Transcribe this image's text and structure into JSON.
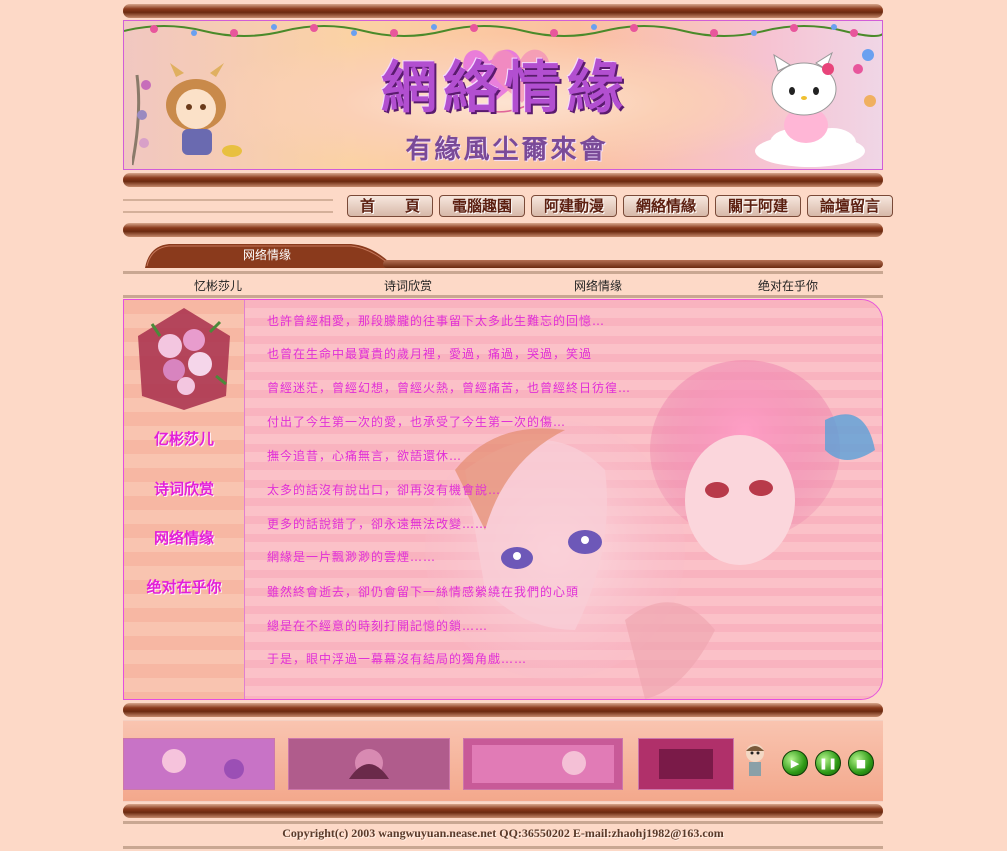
{
  "banner": {
    "title": "網絡情緣",
    "subtitle": "有緣風尘爾來會"
  },
  "nav": {
    "buttons": [
      "首　　頁",
      "電腦趣園",
      "阿建動漫",
      "網絡情緣",
      "關于阿建",
      "論壇留言"
    ]
  },
  "section_tab": {
    "label": "网络情缘"
  },
  "sub_links": [
    "忆彬莎儿",
    "诗词欣赏",
    "网络情缘",
    "绝对在乎你"
  ],
  "sidebar": {
    "items": [
      "亿彬莎儿",
      "诗词欣赏",
      "网络情缘",
      "绝对在乎你"
    ]
  },
  "poem": {
    "lines": [
      "也許曾經相愛，那段朦朧的往事留下太多此生難忘的回憶…",
      "也曾在生命中最寶貴的歲月裡，愛過，痛過，哭過，笑過",
      "曾經迷茫，曾經幻想，曾經火熱，曾經痛苦，也曾經終日彷徨…",
      "付出了今生第一次的愛，也承受了今生第一次的傷…",
      "撫今追昔，心痛無言，欲語還休…",
      "太多的話沒有說出口，卻再沒有機會說…",
      "更多的話說錯了，卻永遠無法改變……",
      "網緣是一片飄渺渺的雲煙……",
      "雖然終會逝去，卻仍會留下一絲情感縈繞在我們的心頭",
      "總是在不經意的時刻打開記憶的鎖……",
      "于是，眼中浮過一幕幕沒有結局的獨角戲……"
    ]
  },
  "player": {
    "play_icon": "play-icon",
    "pause_icon": "pause-icon",
    "stop_icon": "stop-icon"
  },
  "footer": {
    "copyright": "Copyright(c) 2003 wangwuyuan.nease.net QQ:36550202 E-mail:zhaohj1982@163.com"
  },
  "colors": {
    "background": "#fdd9c7",
    "accent_pink": "#e31fd8",
    "bar_brown": "#6b2a10",
    "button_green": "#2e9a16"
  }
}
